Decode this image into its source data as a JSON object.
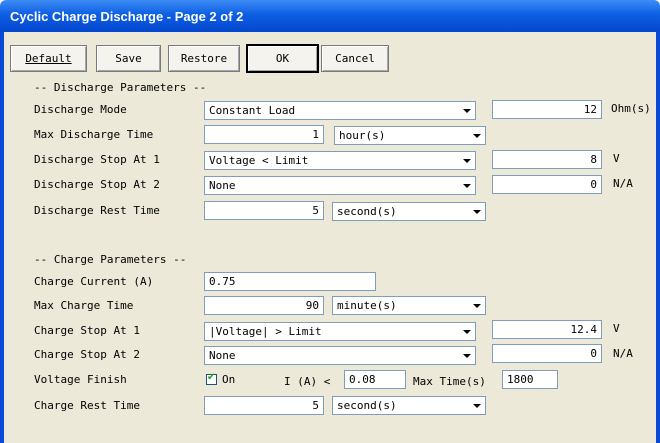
{
  "window": {
    "title": "Cyclic Charge Discharge - Page 2 of 2"
  },
  "toolbar": {
    "default": "Default",
    "save": "Save",
    "restore": "Restore",
    "ok": "OK",
    "cancel": "Cancel"
  },
  "discharge": {
    "header": "-- Discharge Parameters --",
    "mode": {
      "label": "Discharge Mode",
      "value": "Constant Load",
      "param": "12",
      "unit": "Ohm(s)"
    },
    "max_time": {
      "label": "Max Discharge Time",
      "value": "1",
      "unit": "hour(s)"
    },
    "stop1": {
      "label": "Discharge Stop At 1",
      "value": "Voltage < Limit",
      "param": "8",
      "unit": "V"
    },
    "stop2": {
      "label": "Discharge Stop At 2",
      "value": "None",
      "param": "0",
      "unit": "N/A"
    },
    "rest": {
      "label": "Discharge Rest Time",
      "value": "5",
      "unit": "second(s)"
    }
  },
  "charge": {
    "header": "-- Charge Parameters --",
    "current": {
      "label": "Charge Current (A)",
      "value": "0.75"
    },
    "max_time": {
      "label": "Max Charge Time",
      "value": "90",
      "unit": "minute(s)"
    },
    "stop1": {
      "label": "Charge Stop At 1",
      "value": "|Voltage| > Limit",
      "param": "12.4",
      "unit": "V"
    },
    "stop2": {
      "label": "Charge Stop At 2",
      "value": "None",
      "param": "0",
      "unit": "N/A"
    },
    "finish": {
      "label": "Voltage Finish",
      "checkbox_label": "On",
      "checked": true,
      "current_label": "I (A) <",
      "current_value": "0.08",
      "max_time_label": "Max Time(s)",
      "max_time_value": "1800"
    },
    "rest": {
      "label": "Charge Rest Time",
      "value": "5",
      "unit": "second(s)"
    }
  }
}
